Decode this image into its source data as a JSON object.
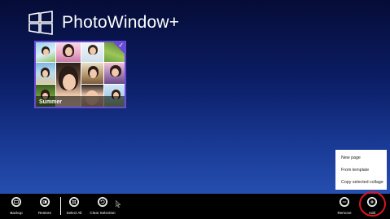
{
  "app": {
    "title": "PhotoWindow+",
    "logo_icon": "windows-logo-icon"
  },
  "collage": {
    "label": "Summer",
    "selected": true,
    "selection_color": "#6a4bd6"
  },
  "popup_menu": {
    "items": [
      {
        "label": "New page"
      },
      {
        "label": "From template"
      },
      {
        "label": "Copy selected collage"
      }
    ]
  },
  "app_bar": {
    "buttons": [
      {
        "label": "Backup",
        "icon": "backup-icon"
      },
      {
        "label": "Restore",
        "icon": "restore-icon"
      },
      {
        "label": "Select All",
        "icon": "select-all-icon"
      },
      {
        "label": "Clear Selection",
        "icon": "clear-selection-icon"
      },
      {
        "label": "Remove",
        "icon": "minus-icon"
      },
      {
        "label": "Add",
        "icon": "plus-icon"
      }
    ]
  },
  "annotation": {
    "highlight_color": "#e0141e"
  }
}
